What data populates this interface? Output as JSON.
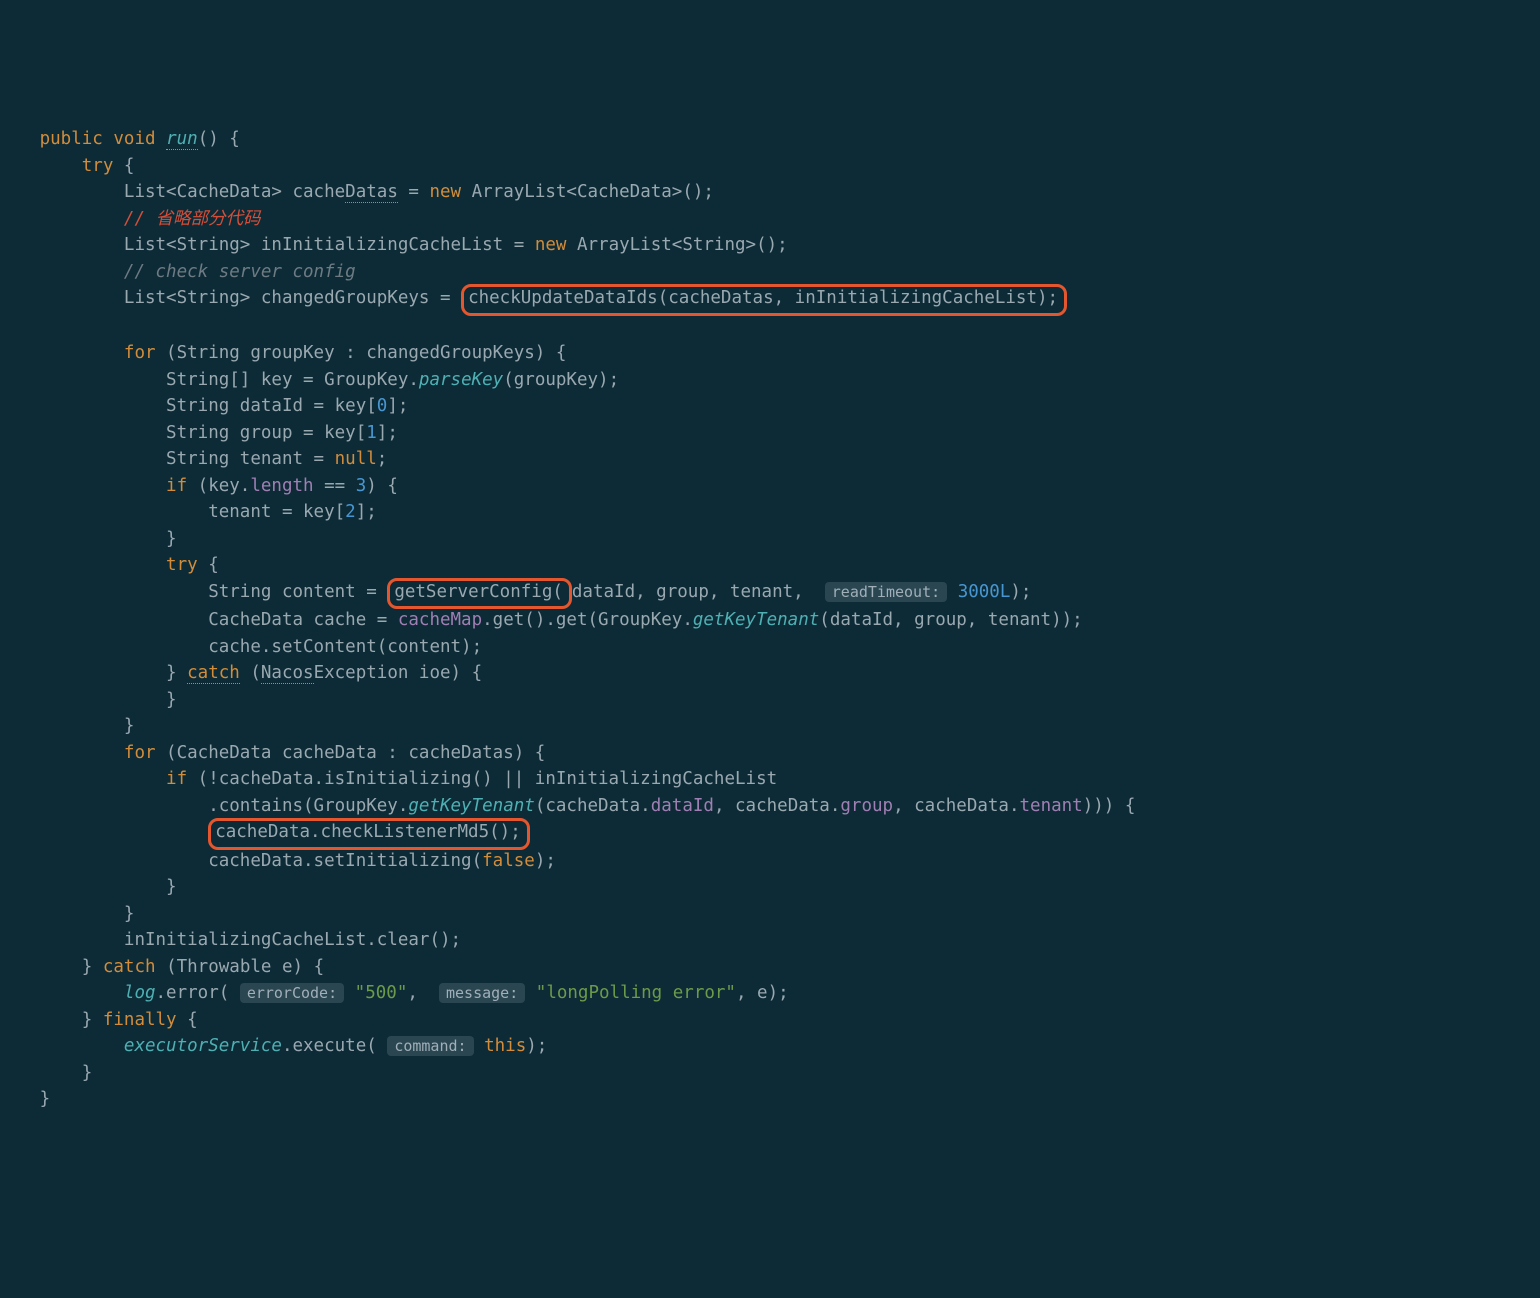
{
  "code": {
    "l1_public": "public",
    "l1_void": "void",
    "l1_run": "run",
    "l1_paren": "() {",
    "l2_try": "try",
    "l2_brace": " {",
    "l3_list": "List<CacheData> cache",
    "l3_datas": "Datas",
    "l3_eq": " = ",
    "l3_new": "new",
    "l3_rest": " ArrayList<CacheData>();",
    "l4_comment": "// 省略部分代码",
    "l5_decl": "List<String> inInitializingCacheList = ",
    "l5_new": "new",
    "l5_rest": " ArrayList<String>();",
    "l6_comment": "// check server config",
    "l7_decl": "List<String> changedGroupKeys = ",
    "l7_call": "checkUpdateDataIds(cacheDatas, inInitializingCacheList);",
    "l9_for": "for",
    "l9_rest": " (String groupKey : changedGroupKeys) {",
    "l10": "String[] key = GroupKey.",
    "l10_m": "parseKey",
    "l10_r": "(groupKey);",
    "l11": "String dataId = key[",
    "l11_n": "0",
    "l11_r": "];",
    "l12": "String group = key[",
    "l12_n": "1",
    "l12_r": "];",
    "l13": "String tenant = ",
    "l13_null": "null",
    "l13_r": ";",
    "l14_if": "if",
    "l14_r": " (key.",
    "l14_len": "length",
    "l14_eq": " == ",
    "l14_n": "3",
    "l14_b": ") {",
    "l15": "tenant = key[",
    "l15_n": "2",
    "l15_r": "];",
    "l16": "}",
    "l17_try": "try",
    "l17_r": " {",
    "l18": "String content = ",
    "l18_box": "getServerConfig(",
    "l18_args": "dataId, group, tenant, ",
    "l18_hint": "readTimeout:",
    "l18_num": "3000L",
    "l18_close": ");",
    "l19": "CacheData cache = ",
    "l19_cm": "cacheMap",
    "l19_g1": ".get().get(GroupKey.",
    "l19_m": "getKeyTenant",
    "l19_r": "(dataId, group, tenant));",
    "l20": "cache.setContent(content);",
    "l21_b": "} ",
    "l21_catch": "catch",
    "l21_p": " (",
    "l21_nacos": "Nacos",
    "l21_r": "Exception ioe) {",
    "l22": "}",
    "l23": "}",
    "l24_for": "for",
    "l24_r": " (CacheData cacheData : cacheDatas) {",
    "l25_if": "if",
    "l25_r": " (!cacheData.isInitializing() || inInitializingCacheList",
    "l26": ".contains(GroupKey.",
    "l26_m": "getKeyTenant",
    "l26_o": "(cacheData.",
    "l26_f1": "dataId",
    "l26_c1": ", cacheData.",
    "l26_f2": "group",
    "l26_c2": ", cacheData.",
    "l26_f3": "tenant",
    "l26_r": "))) {",
    "l27_box": "cacheData.checkListenerMd5();",
    "l28": "cacheData.setInitializing(",
    "l28_false": "false",
    "l28_r": ");",
    "l29": "}",
    "l30": "}",
    "l31": "inInitializingCacheList.clear();",
    "l32_b": "} ",
    "l32_catch": "catch",
    "l32_r": " (Throwable e) {",
    "l33_log": "log",
    "l33_e": ".error( ",
    "l33_h1": "errorCode:",
    "l33_s1": "\"500\"",
    "l33_c": ", ",
    "l33_h2": "message:",
    "l33_s2": "\"longPolling error\"",
    "l33_r": ", e);",
    "l34_b": "} ",
    "l34_fin": "finally",
    "l34_r": " {",
    "l35_es": "executorService",
    "l35_e": ".execute( ",
    "l35_h": "command:",
    "l35_this": "this",
    "l35_r": ");",
    "l36": "}",
    "l37": "}"
  }
}
